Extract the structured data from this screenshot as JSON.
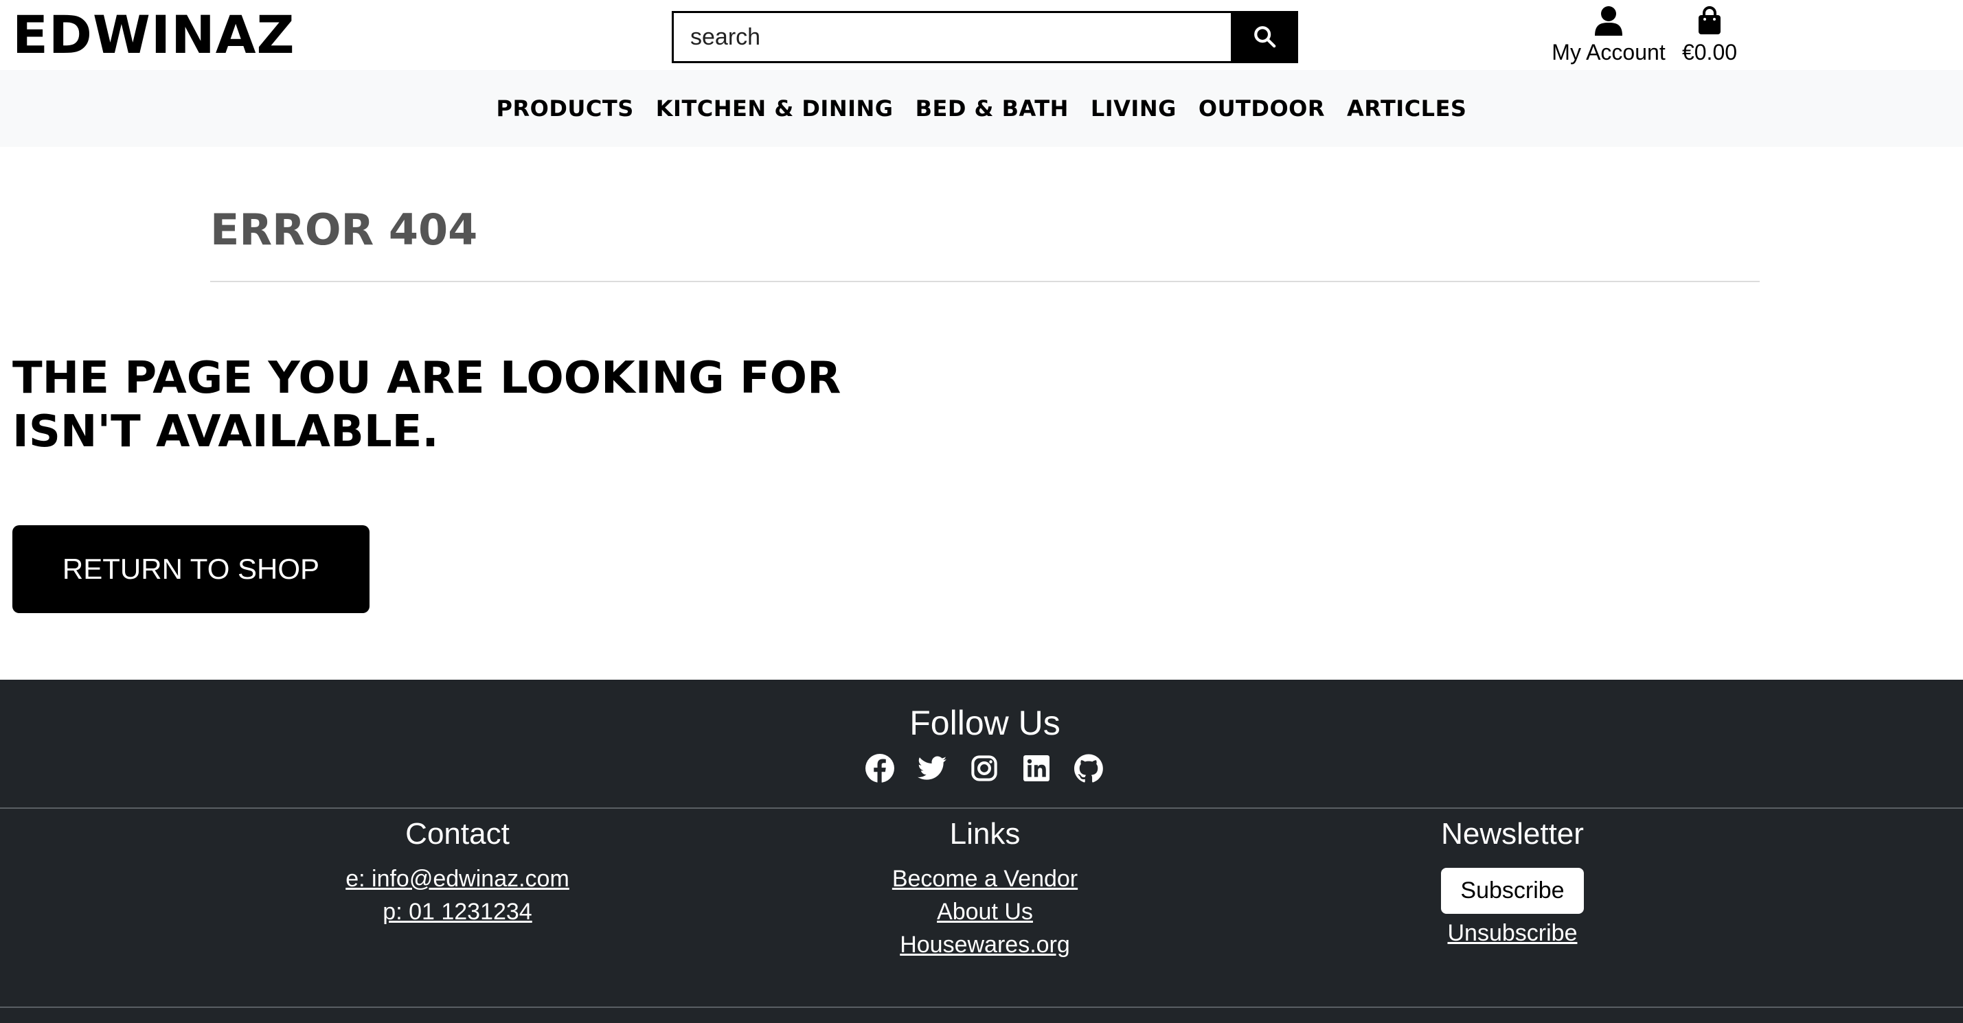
{
  "header": {
    "logo": "EDWINAZ",
    "search_placeholder": "search",
    "account_label": "My Account",
    "cart_total": "€0.00"
  },
  "nav": {
    "items": [
      "PRODUCTS",
      "KITCHEN & DINING",
      "BED & BATH",
      "LIVING",
      "OUTDOOR",
      "ARTICLES"
    ]
  },
  "main": {
    "error_title": "ERROR 404",
    "message": "THE PAGE YOU ARE LOOKING FOR ISN'T AVAILABLE.",
    "return_button": "RETURN TO SHOP"
  },
  "footer": {
    "follow_title": "Follow Us",
    "social_icons": [
      "facebook-icon",
      "twitter-icon",
      "instagram-icon",
      "linkedin-icon",
      "github-icon"
    ],
    "contact": {
      "title": "Contact",
      "email": "e: info@edwinaz.com",
      "phone": "p: 01 1231234"
    },
    "links": {
      "title": "Links",
      "items": [
        "Become a Vendor",
        "About Us",
        "Housewares.org"
      ]
    },
    "newsletter": {
      "title": "Newsletter",
      "subscribe": "Subscribe",
      "unsubscribe": "Unsubscribe"
    }
  },
  "colors": {
    "footer_bg": "#212529",
    "nav_bg": "#f8f9fa",
    "error_title": "#555555"
  }
}
